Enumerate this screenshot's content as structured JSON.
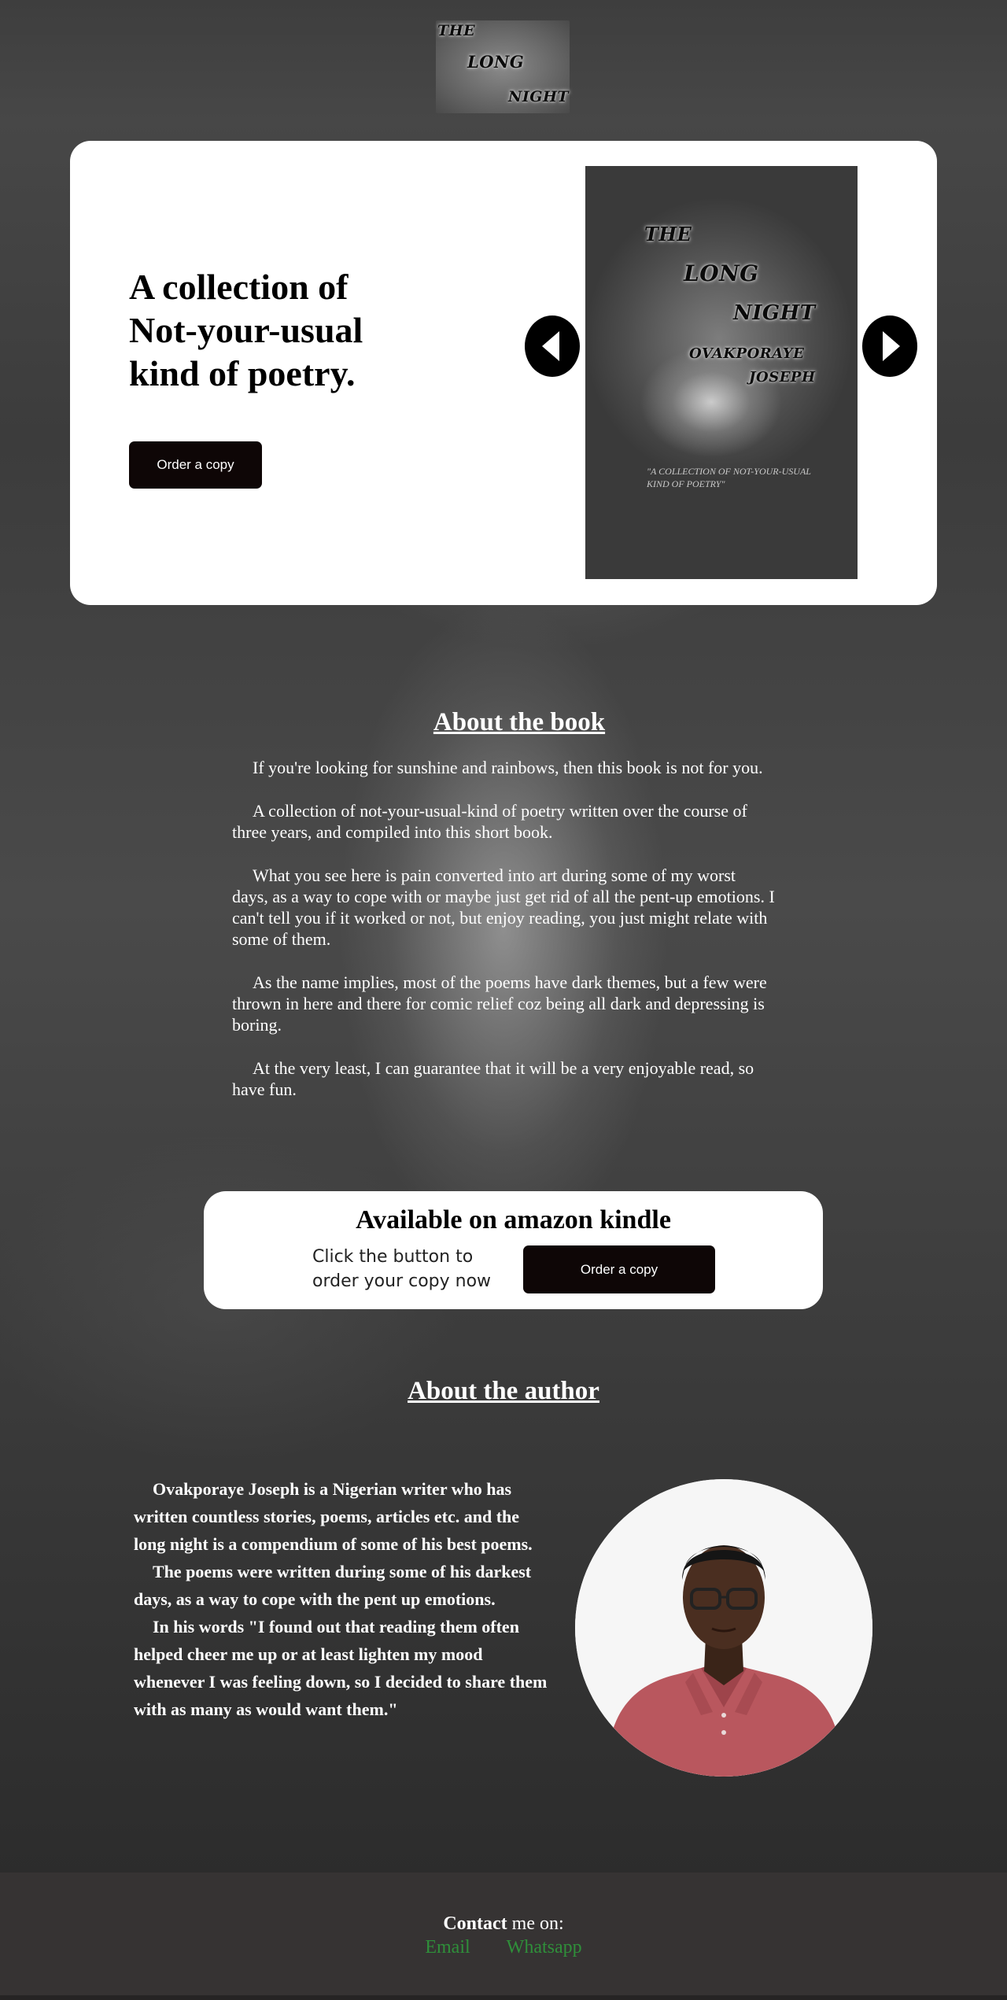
{
  "header": {
    "logo_lines": [
      "THE",
      "LONG",
      "NIGHT"
    ]
  },
  "hero": {
    "heading": "A collection of Not-your-usual kind of poetry.",
    "order_button": "Order a copy",
    "prev_icon": "arrow-left-icon",
    "next_icon": "arrow-right-icon",
    "cover": {
      "title_lines": [
        "THE",
        "LONG",
        "NIGHT"
      ],
      "author_lines": [
        "OVAKPORAYE",
        "JOSEPH"
      ],
      "tagline": "\"A COLLECTION OF NOT-YOUR-USUAL KIND OF POETRY\""
    }
  },
  "about_book": {
    "title": "About the book",
    "paragraphs": [
      "If you're looking for sunshine and rainbows, then this book is not for you.",
      "A collection of not-your-usual-kind of poetry written over the course of three years, and compiled into this short book.",
      "What you see here is pain converted into art during some of my worst days, as a way to cope with or maybe just get rid of all the pent-up emotions. I can't tell you if it worked or not, but enjoy reading, you just might relate with some of them.",
      "As the name implies, most of the poems have dark themes, but a few were thrown in here and there for comic relief coz being all dark and depressing is boring.",
      "At the very least, I can guarantee that it will be a very enjoyable read, so have fun."
    ]
  },
  "kindle": {
    "title": "Available on amazon kindle",
    "text": "Click the button to order your copy now",
    "order_button": "Order a copy"
  },
  "about_author": {
    "title": "About the author",
    "paragraphs": [
      "Ovakporaye Joseph is a Nigerian writer who has written countless stories, poems, articles etc. and the long night is a compendium of some of his best poems.",
      "The poems were written during some of his darkest days, as a way to cope with the pent up emotions.",
      "In his words \"I found out that reading them often helped cheer me up or at least lighten my mood whenever I was feeling down, so I decided to share them with as many as would want them.\""
    ]
  },
  "footer": {
    "contact_bold": "Contact",
    "contact_rest": " me on:",
    "links": [
      "Email",
      "Whatsapp"
    ],
    "link_color": "#2f8f3a"
  }
}
